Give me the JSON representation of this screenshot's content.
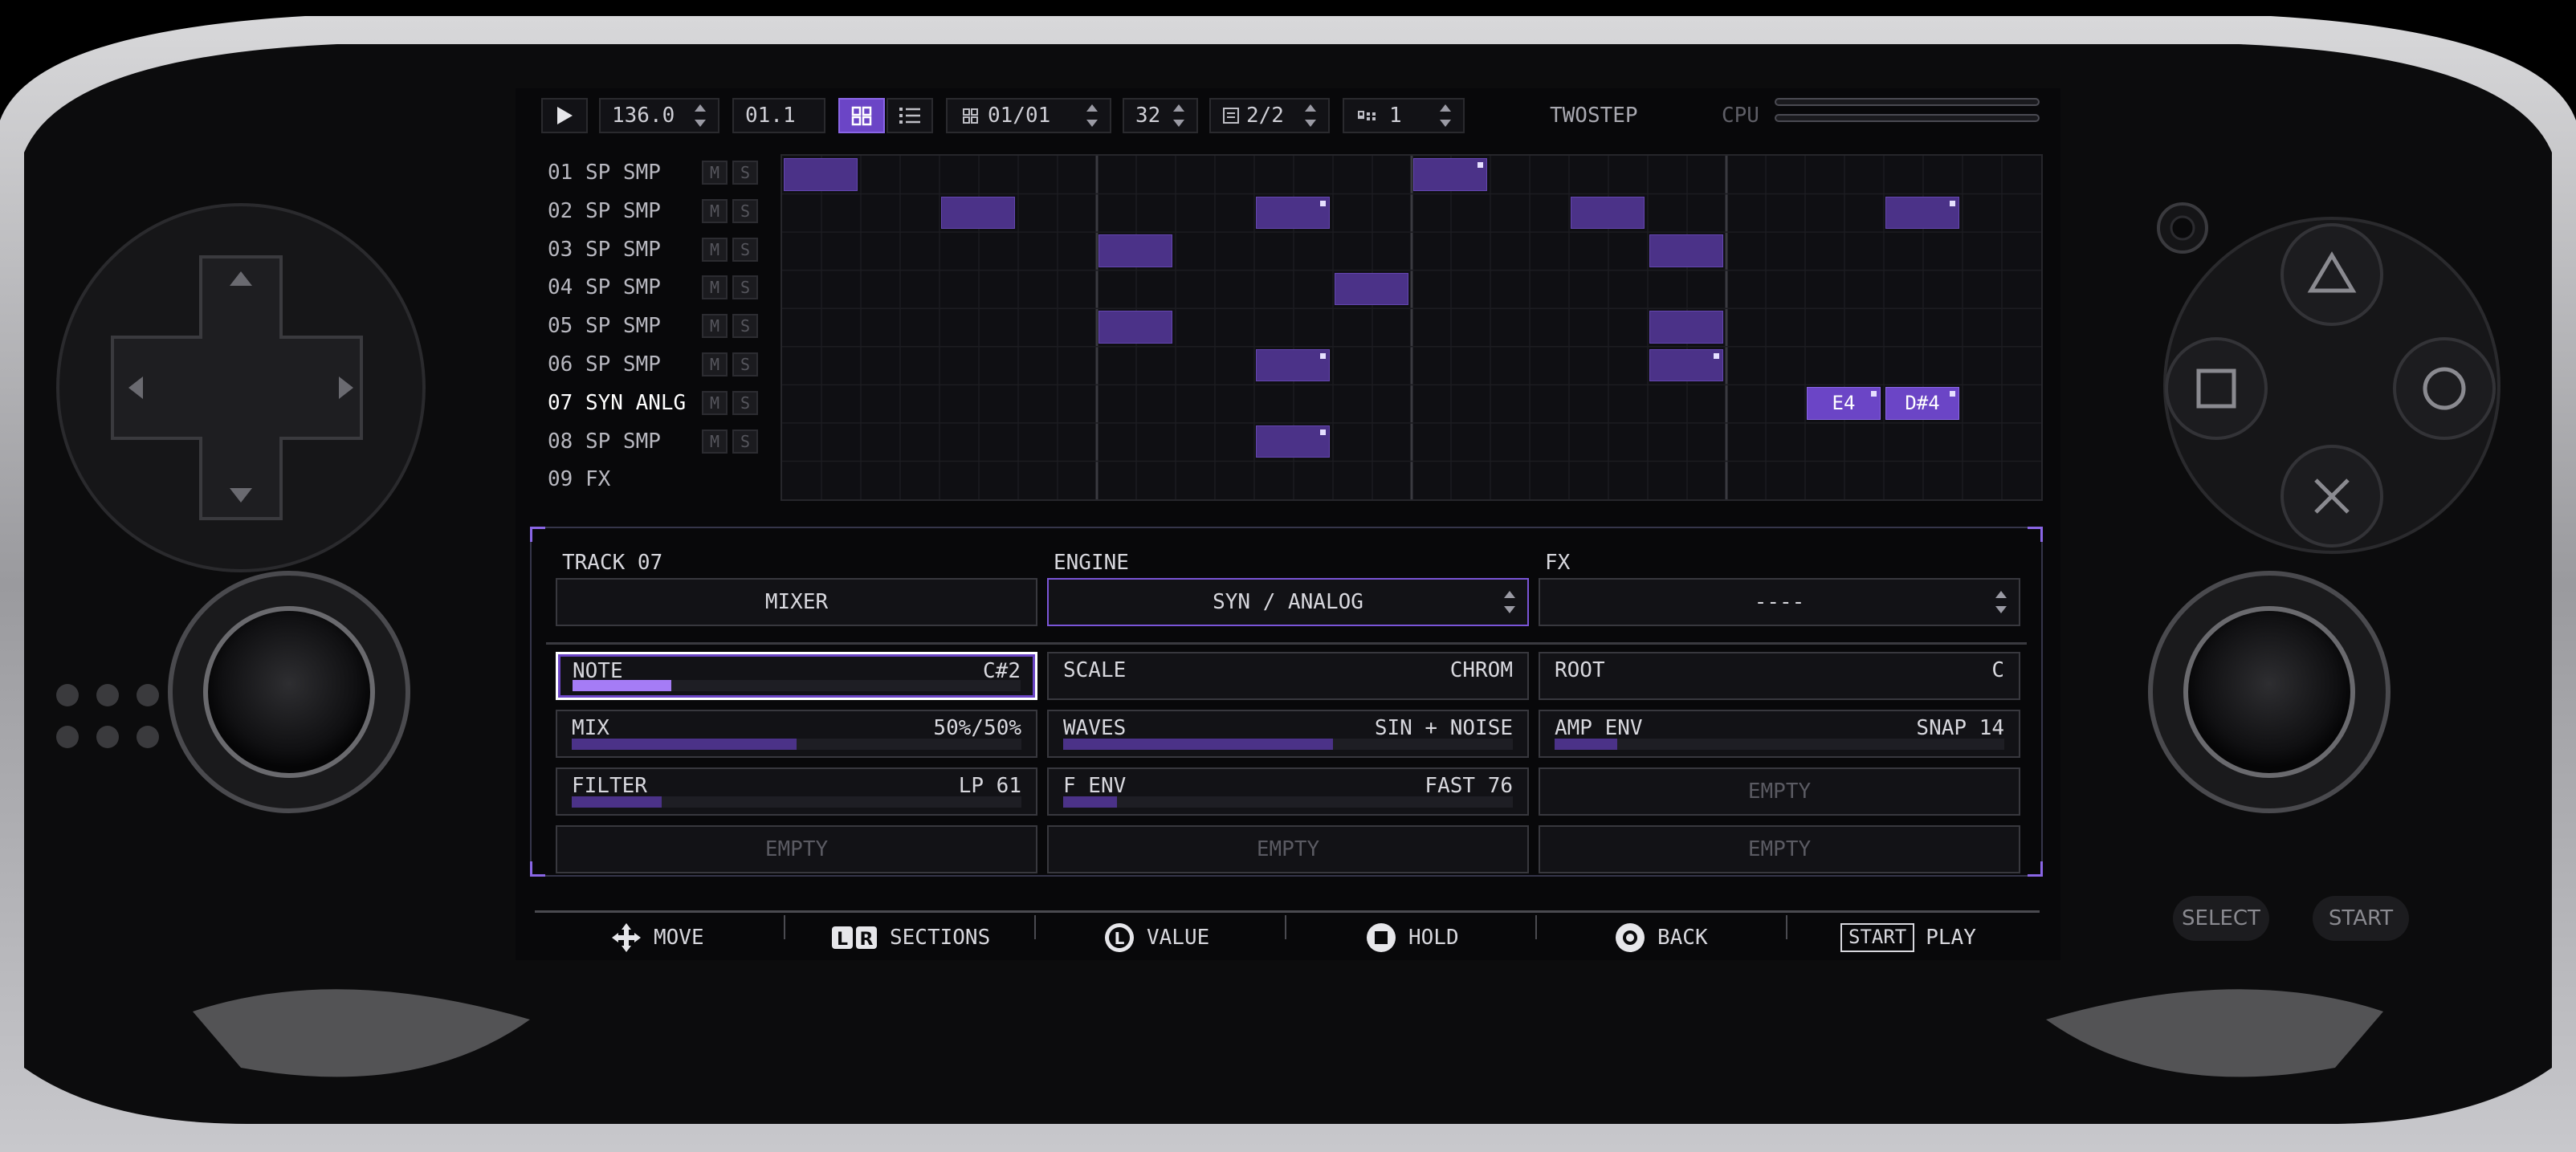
{
  "transport": {
    "play_icon": "play-icon",
    "tempo": "136.0",
    "position": "01.1",
    "pattern": "01/01",
    "steps": "32",
    "page": "2/2",
    "channel": "1",
    "app_name": "TWOSTEP",
    "cpu_label": "CPU"
  },
  "tracks": [
    {
      "label": "01 SP SMP"
    },
    {
      "label": "02 SP SMP"
    },
    {
      "label": "03 SP SMP"
    },
    {
      "label": "04 SP SMP"
    },
    {
      "label": "05 SP SMP"
    },
    {
      "label": "06 SP SMP"
    },
    {
      "label": "07 SYN ANLG"
    },
    {
      "label": "08 SP SMP"
    },
    {
      "label": "09 FX"
    }
  ],
  "mute_label": "M",
  "solo_label": "S",
  "grid": {
    "notes": [
      {
        "track": 1,
        "step": 1
      },
      {
        "track": 1,
        "step": 17,
        "marker": true
      },
      {
        "track": 2,
        "step": 5
      },
      {
        "track": 2,
        "step": 13,
        "marker": true
      },
      {
        "track": 2,
        "step": 21
      },
      {
        "track": 2,
        "step": 29,
        "marker": true
      },
      {
        "track": 3,
        "step": 9
      },
      {
        "track": 3,
        "step": 23
      },
      {
        "track": 4,
        "step": 15
      },
      {
        "track": 5,
        "step": 9
      },
      {
        "track": 5,
        "step": 23
      },
      {
        "track": 6,
        "step": 13,
        "marker": true
      },
      {
        "track": 6,
        "step": 23,
        "marker": true
      },
      {
        "track": 7,
        "step": 27,
        "marker": true,
        "label": "E4"
      },
      {
        "track": 7,
        "step": 29,
        "marker": true,
        "label": "D#4"
      },
      {
        "track": 8,
        "step": 13,
        "marker": true
      }
    ]
  },
  "panel": {
    "track_label": "TRACK 07",
    "engine_label": "ENGINE",
    "fx_label": "FX",
    "mixer_button": "MIXER",
    "engine_value": "SYN / ANALOG",
    "fx_value": "----",
    "params": [
      {
        "name": "NOTE",
        "value": "C#2",
        "level": 0.22,
        "active": true
      },
      {
        "name": "SCALE",
        "value": "CHROM"
      },
      {
        "name": "ROOT",
        "value": "C"
      },
      {
        "name": "MIX",
        "value": "50%/50%",
        "level": 0.5
      },
      {
        "name": "WAVES",
        "value": "SIN + NOISE",
        "level": 0.6
      },
      {
        "name": "AMP ENV",
        "value": "SNAP 14",
        "level": 0.14
      },
      {
        "name": "FILTER",
        "value": "LP 61",
        "level": 0.2
      },
      {
        "name": "F ENV",
        "value": "FAST 76",
        "level": 0.12
      },
      {
        "name": "EMPTY",
        "empty": true
      },
      {
        "name": "EMPTY",
        "empty": true
      },
      {
        "name": "EMPTY",
        "empty": true
      },
      {
        "name": "EMPTY",
        "empty": true
      }
    ]
  },
  "hints": {
    "move": "MOVE",
    "sections": "SECTIONS",
    "value": "VALUE",
    "hold": "HOLD",
    "back": "BACK",
    "start_badge": "START",
    "play": "PLAY"
  },
  "device": {
    "select_label": "SELECT",
    "start_label": "START"
  },
  "colors": {
    "accent": "#6b45c6",
    "note": "#4b3288",
    "active_fill": "#a57cf6"
  }
}
